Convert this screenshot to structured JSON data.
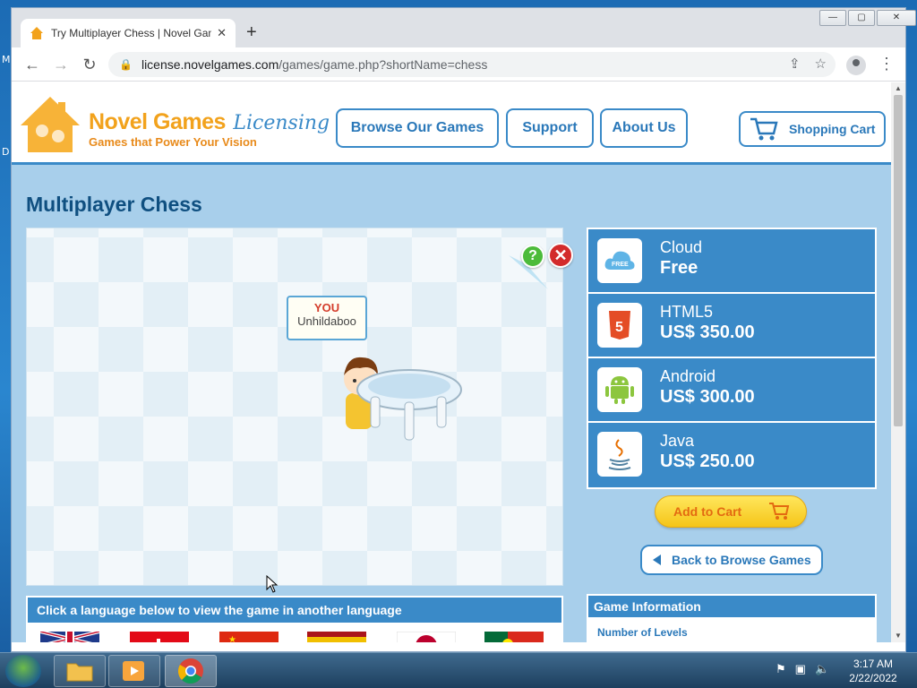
{
  "desktop": {
    "edge_m": "M",
    "edge_d": "D"
  },
  "browser": {
    "tab_title": "Try Multiplayer Chess | Novel Games",
    "tab_close": "✕",
    "new_tab": "+",
    "url_host": "license.novelgames.com",
    "url_path": "/games/game.php?shortName=chess",
    "window_controls": {
      "minimize": "—",
      "maximize": "▢",
      "close": "✕"
    }
  },
  "site": {
    "logo_main": "Novel Games",
    "logo_licensing": "Licensing",
    "logo_tagline": "Games that Power Your Vision",
    "nav": [
      {
        "label": "Browse Our Games"
      },
      {
        "label": "Support"
      },
      {
        "label": "About Us"
      }
    ],
    "cart_label": "Shopping Cart"
  },
  "page": {
    "title": "Multiplayer Chess",
    "game": {
      "help": "?",
      "close": "✕",
      "player_tag": "YOU",
      "player_name": "Unhildaboo"
    },
    "language_bar": "Click a language below to view the game in another language",
    "prices": [
      {
        "name": "Cloud",
        "price": "Free",
        "icon": "cloud-icon",
        "icon_text": "FREE"
      },
      {
        "name": "HTML5",
        "price": "US$ 350.00",
        "icon": "html5-icon",
        "icon_text": "5"
      },
      {
        "name": "Android",
        "price": "US$ 300.00",
        "icon": "android-icon"
      },
      {
        "name": "Java",
        "price": "US$ 250.00",
        "icon": "java-icon"
      }
    ],
    "add_to_cart": "Add to Cart",
    "back_to_browse": "Back to Browse Games",
    "game_info_title": "Game Information",
    "game_info_first_label": "Number of Levels"
  },
  "taskbar": {
    "time": "3:17 AM",
    "date": "2/22/2022"
  },
  "colors": {
    "accent": "#3a8ac8",
    "page_bg": "#a8cfeb",
    "orange": "#f2a21c"
  }
}
